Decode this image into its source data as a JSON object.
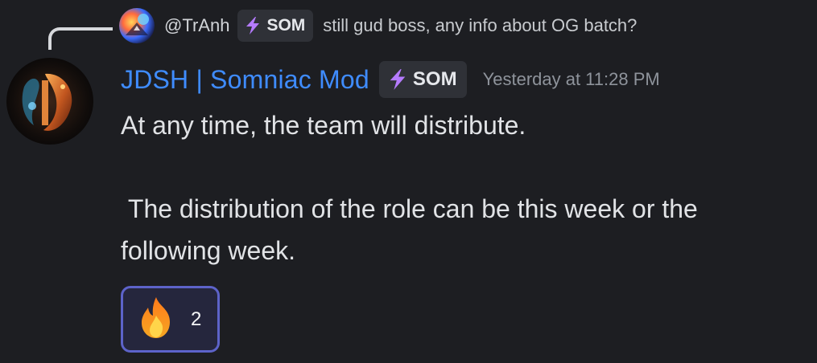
{
  "reply": {
    "avatar_icon": "reply-avatar-icon",
    "username": "@TrAnh",
    "badge": "SOM",
    "text": "still gud boss, any info about OG batch?"
  },
  "message": {
    "avatar_icon": "author-avatar-icon",
    "author": "JDSH | Somniac Mod",
    "badge": "SOM",
    "timestamp": "Yesterday at 11:28 PM",
    "line1": "At any time, the team will distribute.",
    "line2": " The distribution of the role can be this week or the following week."
  },
  "reaction": {
    "emoji_icon": "fire-icon",
    "count": "2"
  },
  "colors": {
    "background": "#1d1e22",
    "author_name": "#3f8cff",
    "badge_bg": "#2f3137",
    "bolt": "#b57bff",
    "reaction_border": "#5d63c9",
    "reaction_bg": "#25263d"
  }
}
